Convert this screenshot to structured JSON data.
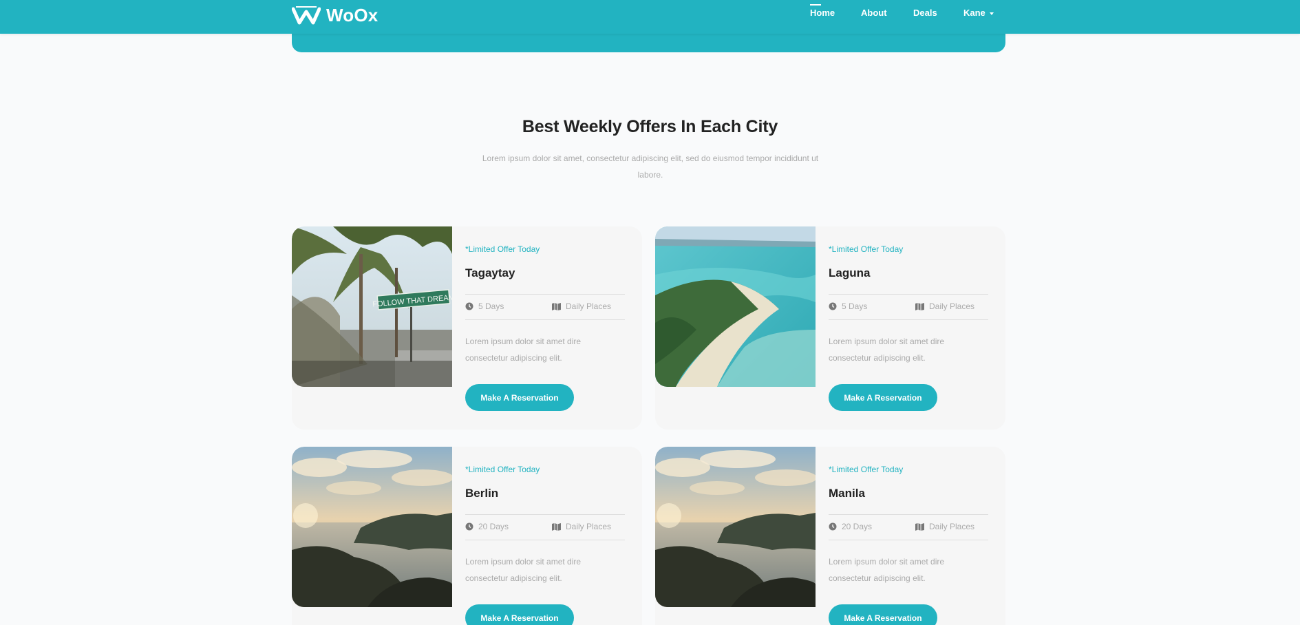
{
  "brand": {
    "name": "WoOx",
    "color": "#22b3c1"
  },
  "nav": [
    {
      "label": "Home",
      "active": true
    },
    {
      "label": "About",
      "active": false
    },
    {
      "label": "Deals",
      "active": false
    },
    {
      "label": "Kane",
      "active": false,
      "dropdown": true
    }
  ],
  "section": {
    "title": "Best Weekly Offers In Each City",
    "description": "Lorem ipsum dolor sit amet, consectetur adipiscing elit, sed do eiusmod tempor incididunt ut labore."
  },
  "offers": [
    {
      "tag": "*Limited Offer Today",
      "city": "Tagaytay",
      "duration": "5 Days",
      "places": "Daily Places",
      "description": "Lorem ipsum dolor sit amet dire consectetur adipiscing elit.",
      "button": "Make A Reservation",
      "image": "palm-street-photo"
    },
    {
      "tag": "*Limited Offer Today",
      "city": "Laguna",
      "duration": "5 Days",
      "places": "Daily Places",
      "description": "Lorem ipsum dolor sit amet dire consectetur adipiscing elit.",
      "button": "Make A Reservation",
      "image": "beach-aerial-photo"
    },
    {
      "tag": "*Limited Offer Today",
      "city": "Berlin",
      "duration": "20 Days",
      "places": "Daily Places",
      "description": "Lorem ipsum dolor sit amet dire consectetur adipiscing elit.",
      "button": "Make A Reservation",
      "image": "coast-sunset-photo"
    },
    {
      "tag": "*Limited Offer Today",
      "city": "Manila",
      "duration": "20 Days",
      "places": "Daily Places",
      "description": "Lorem ipsum dolor sit amet dire consectetur adipiscing elit.",
      "button": "Make A Reservation",
      "image": "coast-sunset-photo"
    }
  ]
}
